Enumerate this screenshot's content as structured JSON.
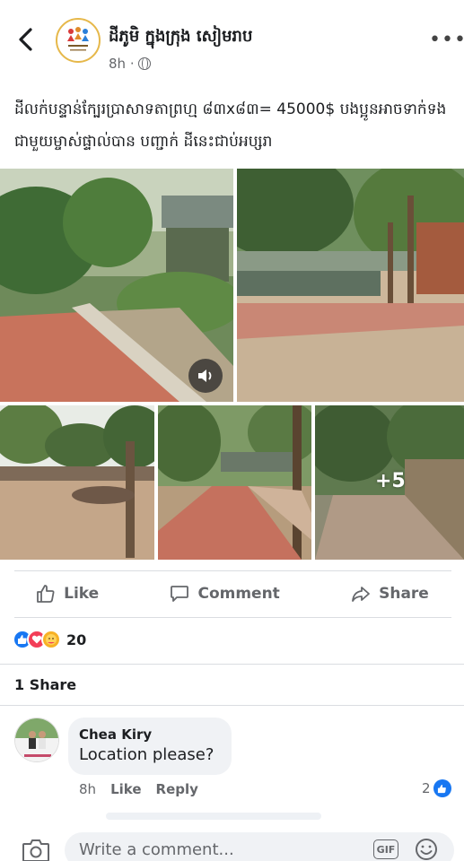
{
  "header": {
    "page_name": "ដីភូមិ ក្នុងក្រុង សៀមរាប",
    "time": "8h ·",
    "avatar_label": "ដីភូមិ"
  },
  "post": {
    "text": "ដីលក់បន្ទាន់ក្បែរប្រាសាទតាព្រហ្ម ៨៣x៨៣= 45000$ បងប្អូនអាចទាក់ទងជាមួយម្ចាស់ផ្ទាល់បាន បញ្ជាក់ ដីនេះជាប់អប្សរា",
    "photos": [
      {
        "name": "garden-walkway-photo"
      },
      {
        "name": "coconut-trees-photo"
      },
      {
        "name": "dirt-yard-photo"
      },
      {
        "name": "tiled-path-photo"
      },
      {
        "name": "fence-path-photo"
      }
    ],
    "more_photos": "+5"
  },
  "actions": {
    "like": "Like",
    "comment": "Comment",
    "share": "Share"
  },
  "reactions": {
    "count": "20",
    "types": [
      "like",
      "love",
      "care"
    ]
  },
  "shares": "1 Share",
  "comment": {
    "author": "Chea Kiry",
    "text": "Location please?",
    "time": "8h",
    "like_label": "Like",
    "reply_label": "Reply",
    "like_count": "2"
  },
  "composer": {
    "placeholder": "Write a comment...",
    "gif_label": "GIF"
  },
  "colors": {
    "accent": "#1877f2",
    "muted": "#65676b",
    "bubble": "#f0f2f5"
  }
}
